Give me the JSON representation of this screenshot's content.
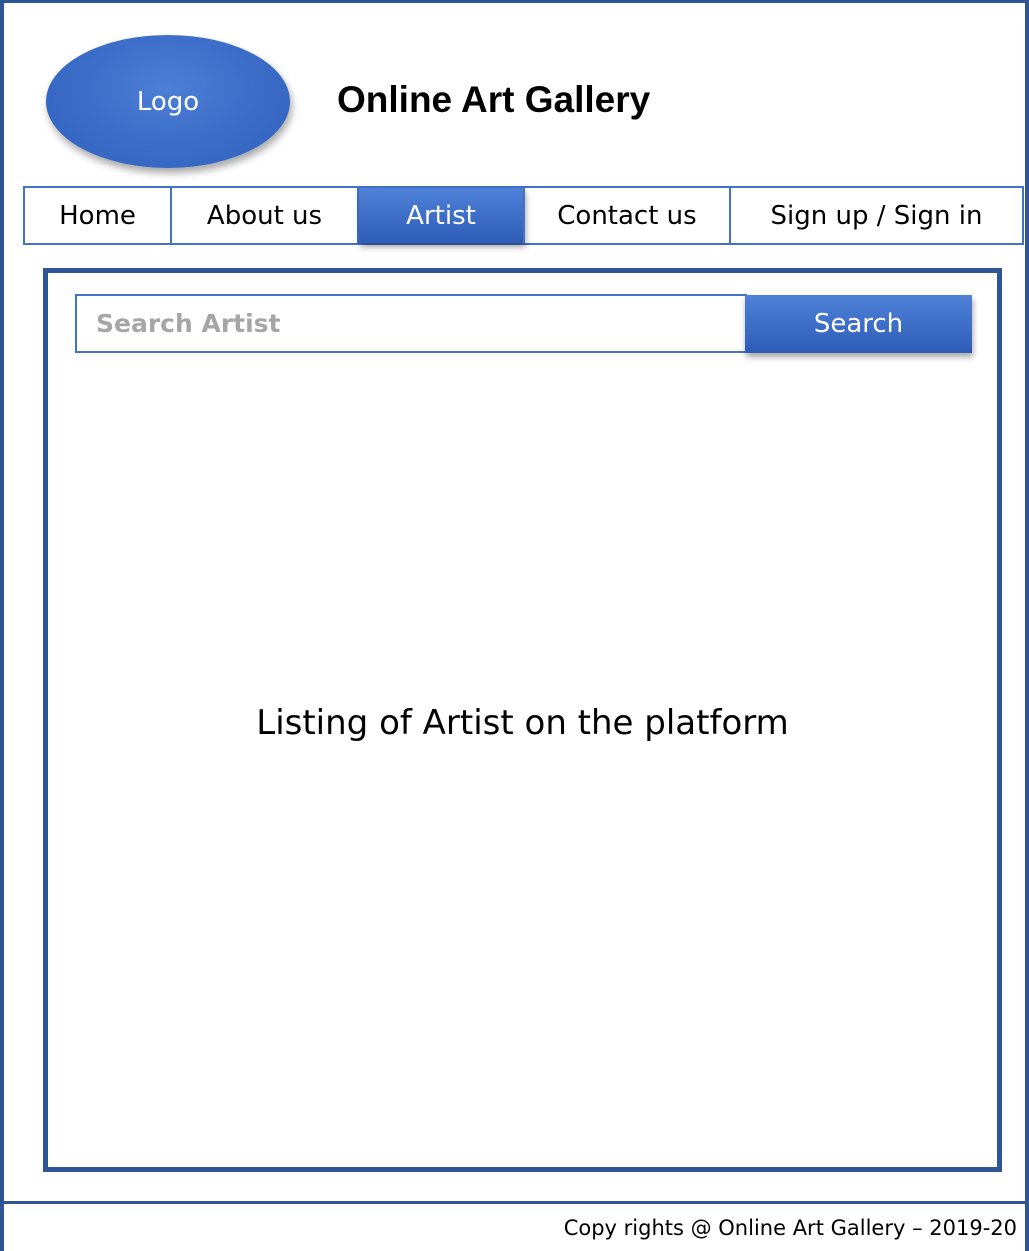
{
  "header": {
    "logo_label": "Logo",
    "title": "Online Art Gallery"
  },
  "nav": {
    "items": [
      {
        "label": "Home",
        "active": false
      },
      {
        "label": "About us",
        "active": false
      },
      {
        "label": "Artist",
        "active": true
      },
      {
        "label": "Contact us",
        "active": false
      },
      {
        "label": "Sign up / Sign in",
        "active": false
      }
    ]
  },
  "search": {
    "placeholder": "Search Artist",
    "value": "",
    "button_label": "Search"
  },
  "main": {
    "listing_text": "Listing of Artist on the platform"
  },
  "footer": {
    "copyright": "Copy rights @ Online Art Gallery – 2019-20"
  },
  "colors": {
    "accent": "#4472c4",
    "border": "#2f5597"
  }
}
